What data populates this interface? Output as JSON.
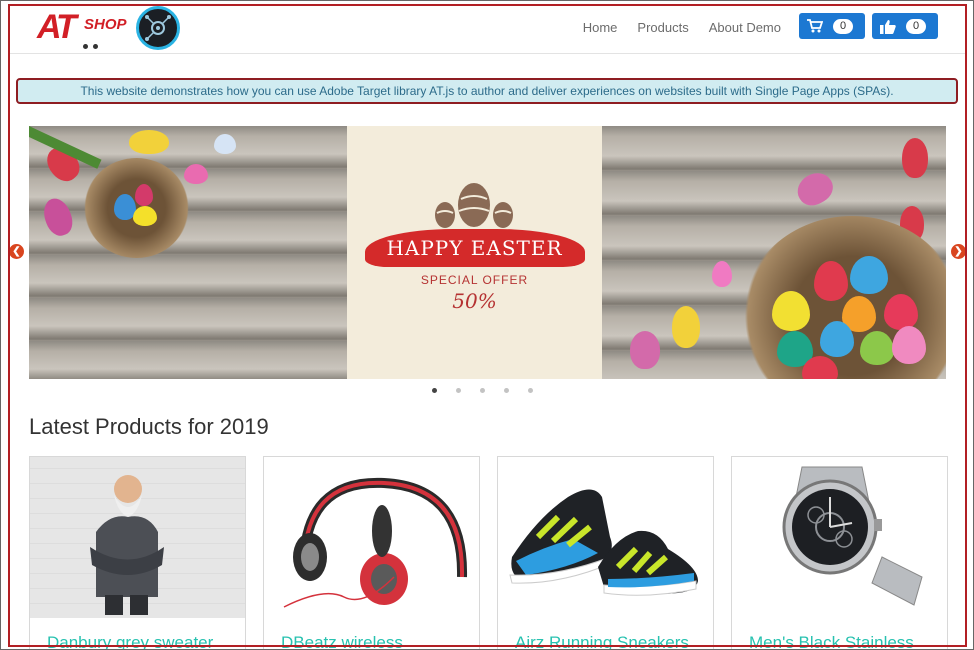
{
  "brand": {
    "logo_text": "AT",
    "logo_suffix": "SHOP"
  },
  "nav": {
    "links": [
      "Home",
      "Products",
      "About Demo"
    ],
    "cart_count": "0",
    "like_count": "0"
  },
  "info_banner": "This website demonstrates how you can use Adobe Target library AT.js to author and deliver experiences on websites built with Single Page Apps (SPAs).",
  "carousel": {
    "headline": "HAPPY EASTER",
    "subline": "SPECIAL OFFER",
    "discount": "50%",
    "slide_count": 5,
    "active_slide": 1
  },
  "section_title": "Latest Products for 2019",
  "products": [
    {
      "name": "Danbury grey sweater"
    },
    {
      "name": "DBeatz wireless"
    },
    {
      "name": "Airz Running Sneakers"
    },
    {
      "name": "Men's Black Stainless"
    }
  ],
  "colors": {
    "brand_red": "#d21f26",
    "nav_button": "#1c78d2",
    "product_title": "#28c2b0",
    "banner_bg": "#d1ecf1"
  }
}
